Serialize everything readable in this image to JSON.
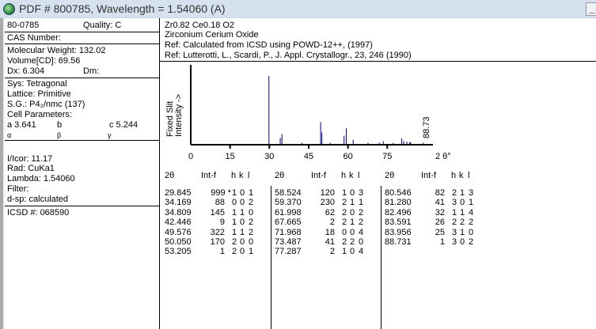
{
  "window": {
    "title": "PDF # 800785,  Wavelength = 1.54060   (A)",
    "minimize": "_"
  },
  "left": {
    "pdf_number": "80-0785",
    "quality": "Quality: C",
    "cas": "CAS Number:",
    "mol_weight": "Molecular Weight:  132.02",
    "volume": "Volume[CD]:    69.56",
    "dx": "Dx:  6.304",
    "dm": "Dm:",
    "sys": "Sys: Tetragonal",
    "lattice": "Lattice: Primitive",
    "sg": "S.G.: P4₂/nmc (137)",
    "cell": "Cell Parameters:",
    "a": "a  3.641",
    "b": "b",
    "c": "c  5.244",
    "alpha": "α",
    "beta": "β",
    "gamma": "γ",
    "icor": "I/Icor:  11.17",
    "rad": "Rad: CuKa1",
    "lambda": "Lambda: 1.54060",
    "filter": "Filter:",
    "dsp": "d-sp: calculated",
    "icsd": "ICSD #:  068590"
  },
  "header": {
    "formula": "Zr0.82 Ce0.18 O2",
    "name": "Zirconium Cerium Oxide",
    "ref1": "Ref:  Calculated from ICSD using POWD-12++, (1997)",
    "ref2": "Ref: Lutterotti, L., Scardi, P., J. Appl. Crystallogr., 23, 246 (1990)"
  },
  "pattern": {
    "ylabel1": "Fixed   Slit",
    "ylabel2": "Intensity  ->",
    "xlabel": "2 θ°",
    "xticks": [
      "0",
      "15",
      "30",
      "45",
      "60",
      "75"
    ],
    "xmax_label": "88.73",
    "color": "#00008b"
  },
  "table": {
    "headers": [
      "2θ",
      "Int-f",
      "h",
      "k",
      "l"
    ],
    "rows": [
      [
        "29.845",
        "999 *",
        "1",
        "0",
        "1"
      ],
      [
        "34.169",
        "88",
        "0",
        "0",
        "2"
      ],
      [
        "34.809",
        "145",
        "1",
        "1",
        "0"
      ],
      [
        "42.446",
        "9",
        "1",
        "0",
        "2"
      ],
      [
        "49.576",
        "322",
        "1",
        "1",
        "2"
      ],
      [
        "50.050",
        "170",
        "2",
        "0",
        "0"
      ],
      [
        "53.205",
        "1",
        "2",
        "0",
        "1"
      ],
      [
        "58.524",
        "120",
        "1",
        "0",
        "3"
      ],
      [
        "59.370",
        "230",
        "2",
        "1",
        "1"
      ],
      [
        "61.998",
        "62",
        "2",
        "0",
        "2"
      ],
      [
        "67.665",
        "2",
        "2",
        "1",
        "2"
      ],
      [
        "71.968",
        "18",
        "0",
        "0",
        "4"
      ],
      [
        "73.487",
        "41",
        "2",
        "2",
        "0"
      ],
      [
        "77.287",
        "2",
        "1",
        "0",
        "4"
      ],
      [
        "80.546",
        "82",
        "2",
        "1",
        "3"
      ],
      [
        "81.280",
        "41",
        "3",
        "0",
        "1"
      ],
      [
        "82.496",
        "32",
        "1",
        "1",
        "4"
      ],
      [
        "83.591",
        "26",
        "2",
        "2",
        "2"
      ],
      [
        "83.956",
        "25",
        "3",
        "1",
        "0"
      ],
      [
        "88.731",
        "1",
        "3",
        "0",
        "2"
      ]
    ]
  }
}
